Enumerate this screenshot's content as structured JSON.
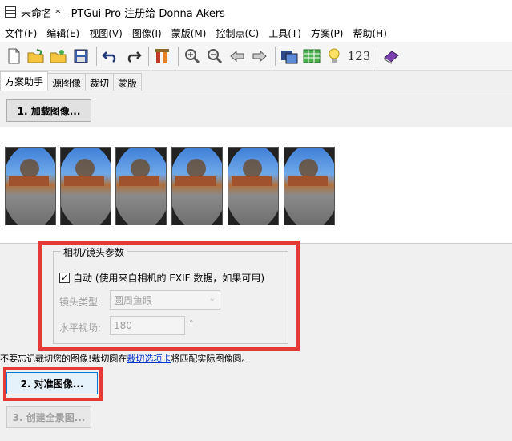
{
  "window": {
    "title": "未命名 * - PTGui Pro 注册给 Donna Akers"
  },
  "menu": [
    "文件(F)",
    "编辑(E)",
    "视图(V)",
    "图像(I)",
    "蒙版(M)",
    "控制点(C)",
    "工具(T)",
    "方案(P)",
    "帮助(H)"
  ],
  "toolbar": {
    "number_label": "123"
  },
  "tabs": [
    "方案助手",
    "源图像",
    "裁切",
    "蒙版"
  ],
  "buttons": {
    "load": "1. 加载图像...",
    "align": "2. 对准图像...",
    "create": "3. 创建全景图..."
  },
  "camera": {
    "group_title": "相机/镜头参数",
    "auto_checkbox": "自动 (使用来自相机的 EXIF 数据，如果可用)",
    "lens_type_label": "镜头类型:",
    "lens_type_value": "圆周鱼眼",
    "hfov_label": "水平视场:",
    "hfov_value": "180",
    "hfov_unit": "°"
  },
  "hint": {
    "before": "不要忘记裁切您的图像!裁切圆在",
    "link": "裁切选项卡",
    "after": "将匹配实际图像圆。"
  },
  "colors": {
    "highlight": "#e53935",
    "link": "#0033cc"
  }
}
